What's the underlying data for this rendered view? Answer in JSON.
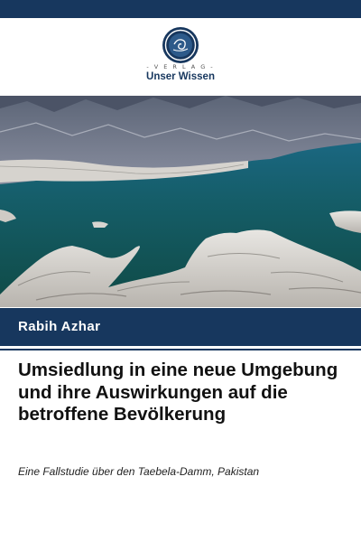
{
  "publisher": {
    "verlag_label": "- V E R L A G -",
    "name": "Unser Wissen",
    "icon": "globe-badge-icon",
    "brand_color": "#17375e"
  },
  "cover_image": {
    "subject": "mountain-lake-landscape"
  },
  "book": {
    "author": "Rabih Azhar",
    "title": "Umsiedlung in eine neue Umgebung und ihre Auswirkungen auf die betroffene Bevölkerung",
    "subtitle": "Eine Fallstudie über den Taebela-Damm, Pakistan"
  }
}
